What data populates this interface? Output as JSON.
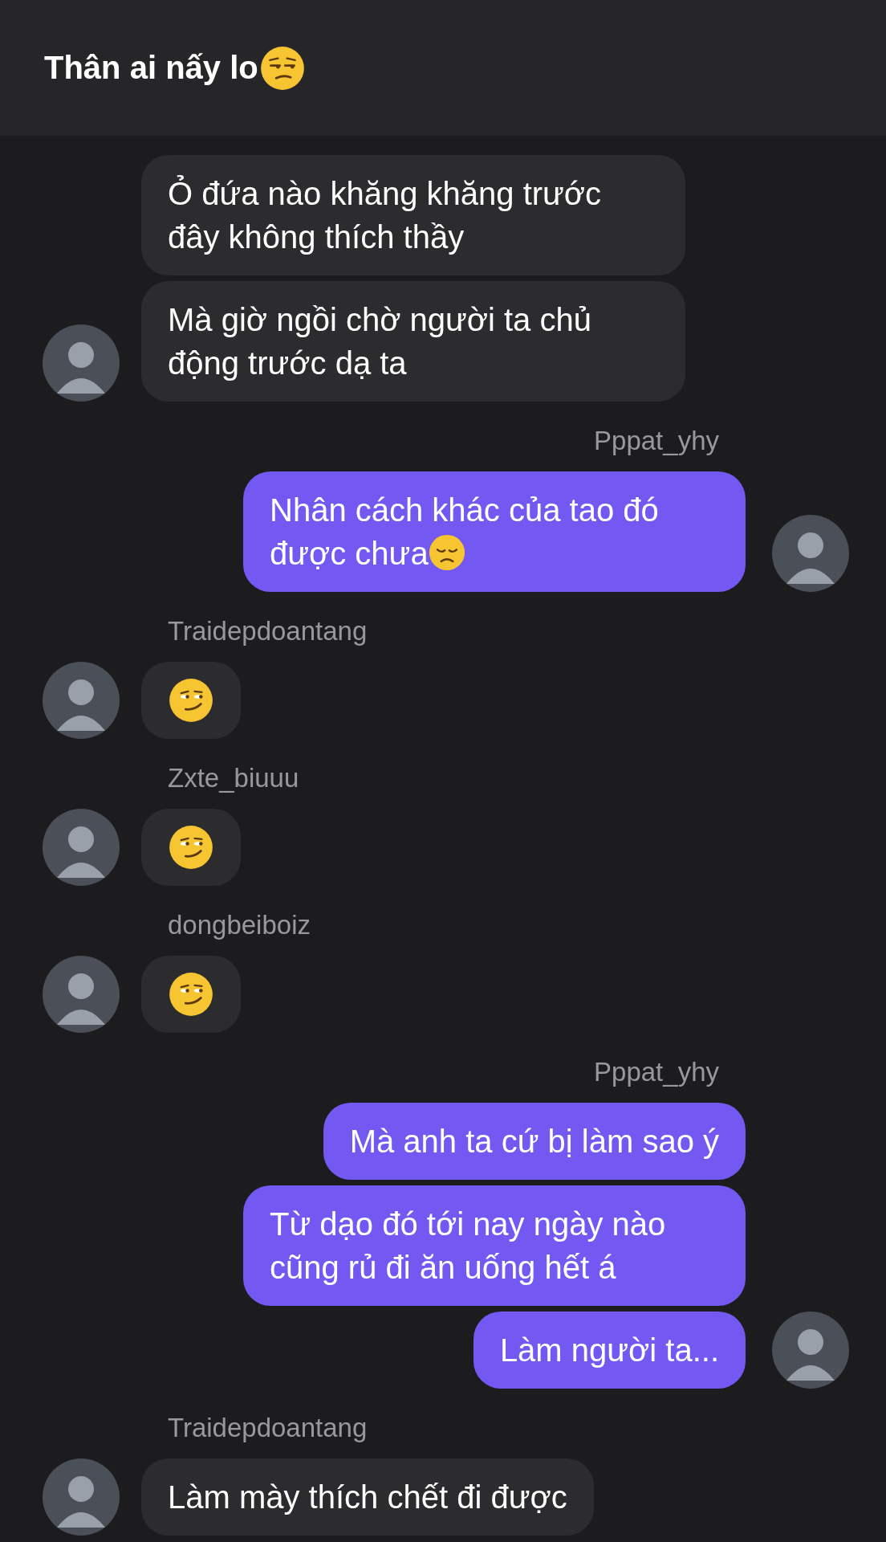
{
  "header": {
    "title": "Thân ai nấy lo",
    "kind": "unamused"
  },
  "groups": [
    {
      "kind": "incoming",
      "messages": [
        {
          "kind": "plain",
          "text": "Ỏ đứa nào khăng khăng trước đây không thích thầy"
        },
        {
          "kind": "plain",
          "text": "Mà giờ ngồi chờ người ta chủ động trước dạ ta"
        }
      ]
    },
    {
      "kind": "outgoing",
      "sender": "Pppat_yhy",
      "messages": [
        {
          "kind": "disappointed",
          "text": "Nhân cách khác của tao đó được chưa"
        }
      ]
    },
    {
      "kind": "incoming",
      "sender": "Traidepdoantang",
      "messages": [
        {
          "kind": "smirk"
        }
      ]
    },
    {
      "kind": "incoming",
      "sender": "Zxte_biuuu",
      "messages": [
        {
          "kind": "smirk"
        }
      ]
    },
    {
      "kind": "incoming",
      "sender": "dongbeiboiz",
      "messages": [
        {
          "kind": "smirk"
        }
      ]
    },
    {
      "kind": "outgoing",
      "sender": "Pppat_yhy",
      "messages": [
        {
          "kind": "plain",
          "text": "Mà anh ta cứ bị làm sao ý"
        },
        {
          "kind": "plain",
          "text": "Từ dạo đó tới nay ngày nào cũng rủ đi ăn uống hết á"
        },
        {
          "kind": "plain",
          "text": "Làm người ta..."
        }
      ]
    },
    {
      "kind": "incoming",
      "sender": "Traidepdoantang",
      "messages": [
        {
          "kind": "plain",
          "text": "Làm mày thích chết đi được"
        }
      ]
    }
  ]
}
